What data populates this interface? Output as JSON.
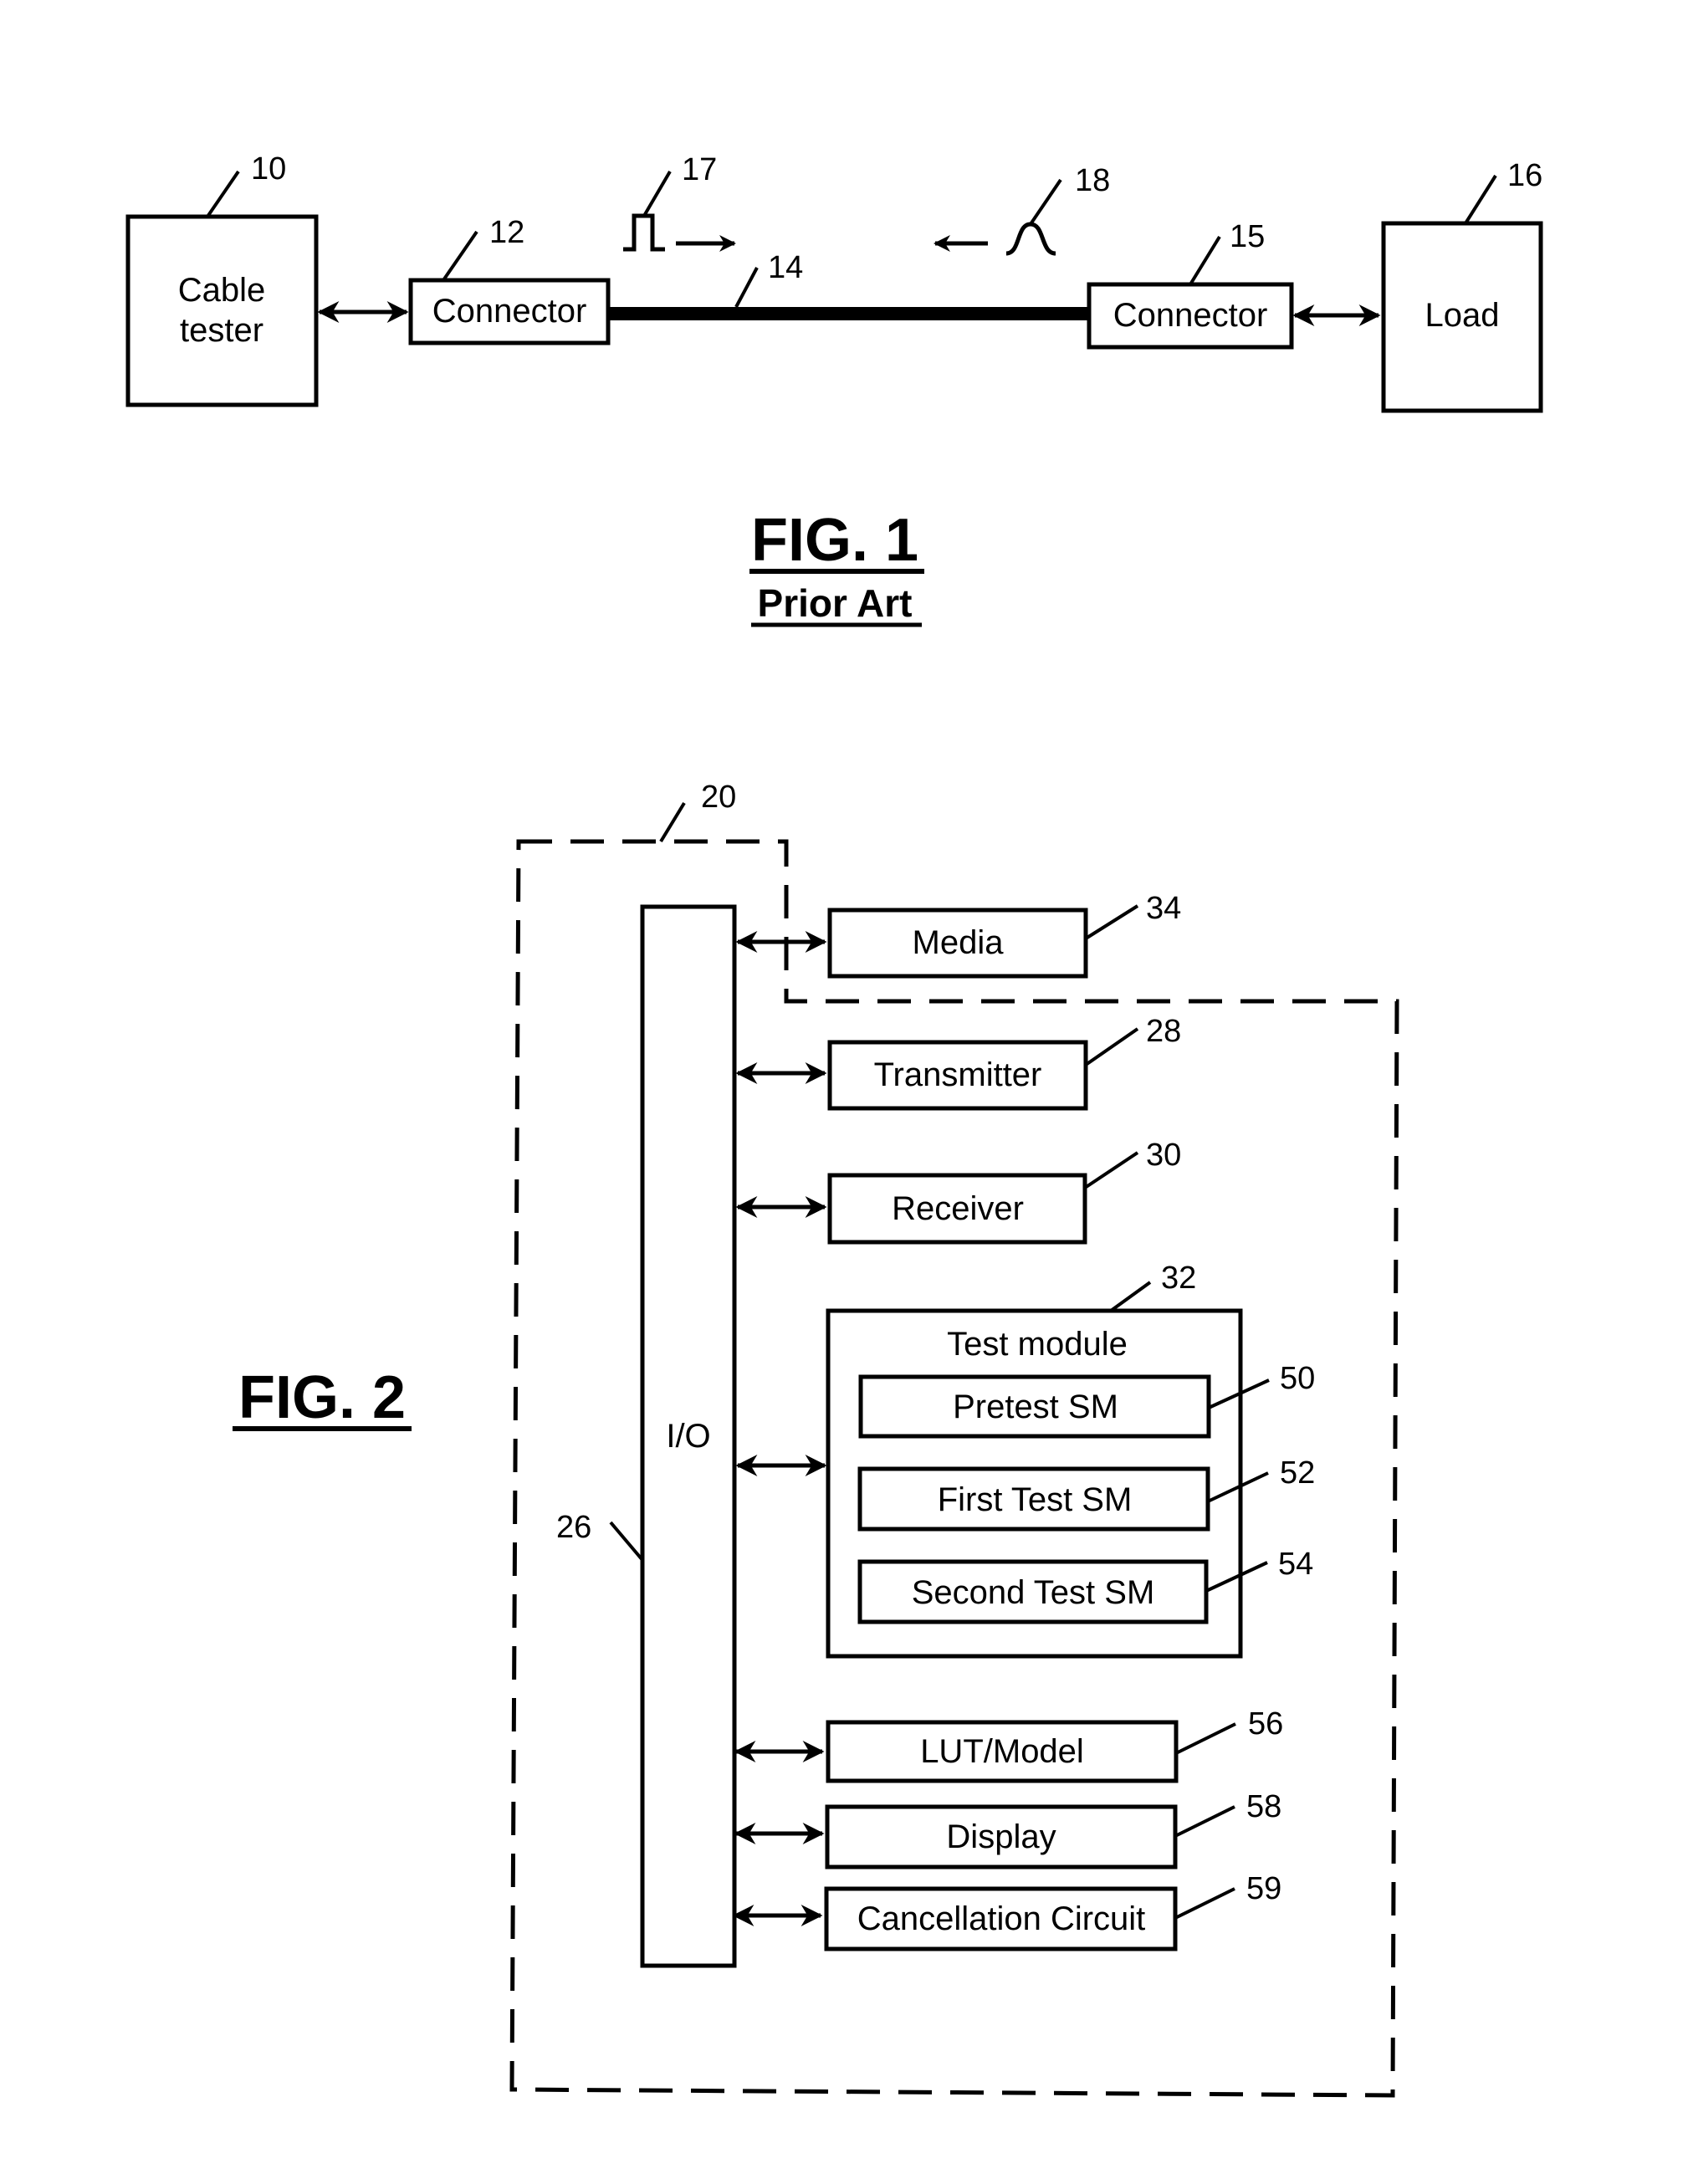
{
  "fig1": {
    "title": "FIG. 1",
    "subtitle": "Prior Art",
    "blocks": {
      "cable_tester": {
        "lines": [
          "Cable",
          "tester"
        ],
        "ref": "10"
      },
      "connector_left": {
        "label": "Connector",
        "ref": "12"
      },
      "cable": {
        "ref": "14"
      },
      "connector_right": {
        "label": "Connector",
        "ref": "15"
      },
      "load": {
        "label": "Load",
        "ref": "16"
      },
      "pulse": {
        "ref": "17"
      },
      "reflection": {
        "ref": "18"
      }
    }
  },
  "fig2": {
    "title": "FIG. 2",
    "system_ref": "20",
    "io": {
      "label": "I/O",
      "ref": "26"
    },
    "media": {
      "label": "Media",
      "ref": "34"
    },
    "transmitter": {
      "label": "Transmitter",
      "ref": "28"
    },
    "receiver": {
      "label": "Receiver",
      "ref": "30"
    },
    "test_module": {
      "label": "Test module",
      "ref": "32",
      "submodules": [
        {
          "label": "Pretest SM",
          "ref": "50"
        },
        {
          "label": "First Test SM",
          "ref": "52"
        },
        {
          "label": "Second Test SM",
          "ref": "54"
        }
      ]
    },
    "lut_model": {
      "label": "LUT/Model",
      "ref": "56"
    },
    "display": {
      "label": "Display",
      "ref": "58"
    },
    "cancellation": {
      "label": "Cancellation Circuit",
      "ref": "59"
    }
  }
}
